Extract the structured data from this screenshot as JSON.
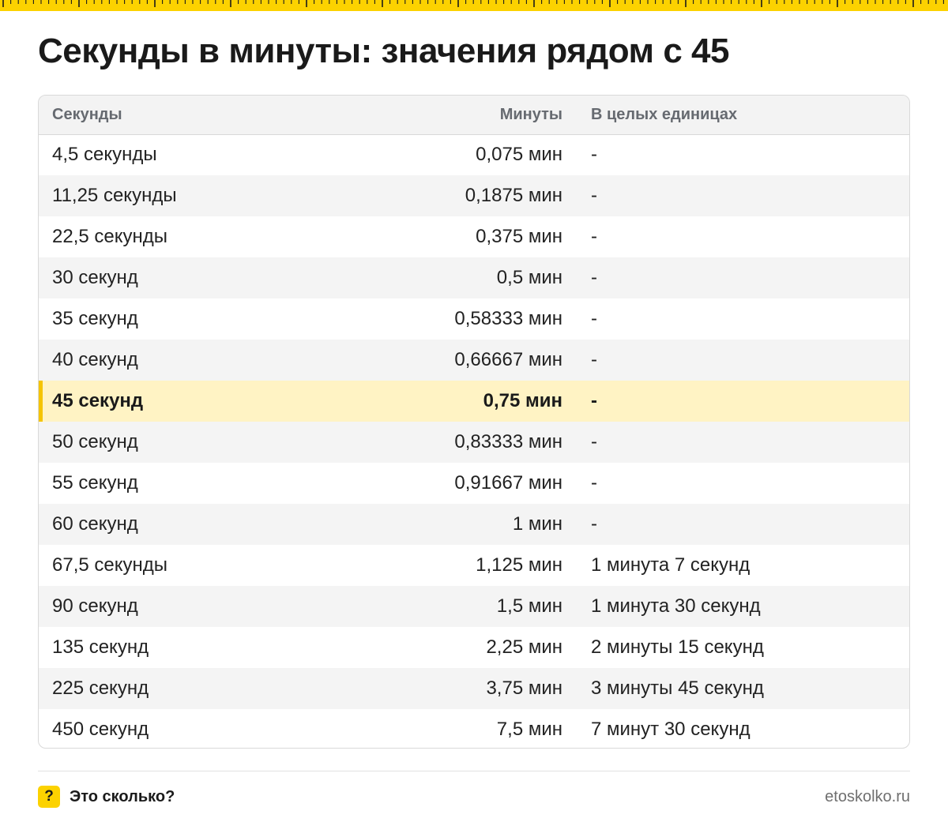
{
  "page": {
    "title": "Секунды в минуты: значения рядом с 45",
    "accent_color": "#fcd200",
    "highlight_color": "#fff3c4"
  },
  "table": {
    "headers": {
      "seconds": "Секунды",
      "minutes": "Минуты",
      "whole_units": "В целых единицах"
    },
    "highlighted_row": 6,
    "rows": [
      {
        "seconds": "4,5 секунды",
        "minutes": "0,075 мин",
        "whole": "-"
      },
      {
        "seconds": "11,25 секунды",
        "minutes": "0,1875 мин",
        "whole": "-"
      },
      {
        "seconds": "22,5 секунды",
        "minutes": "0,375 мин",
        "whole": "-"
      },
      {
        "seconds": "30 секунд",
        "minutes": "0,5 мин",
        "whole": "-"
      },
      {
        "seconds": "35 секунд",
        "minutes": "0,58333 мин",
        "whole": "-"
      },
      {
        "seconds": "40 секунд",
        "minutes": "0,66667 мин",
        "whole": "-"
      },
      {
        "seconds": "45 секунд",
        "minutes": "0,75 мин",
        "whole": "-"
      },
      {
        "seconds": "50 секунд",
        "minutes": "0,83333 мин",
        "whole": "-"
      },
      {
        "seconds": "55 секунд",
        "minutes": "0,91667 мин",
        "whole": "-"
      },
      {
        "seconds": "60 секунд",
        "minutes": "1 мин",
        "whole": "-"
      },
      {
        "seconds": "67,5 секунды",
        "minutes": "1,125 мин",
        "whole": "1 минута 7 секунд"
      },
      {
        "seconds": "90 секунд",
        "minutes": "1,5 мин",
        "whole": "1 минута 30 секунд"
      },
      {
        "seconds": "135 секунд",
        "minutes": "2,25 мин",
        "whole": "2 минуты 15 секунд"
      },
      {
        "seconds": "225 секунд",
        "minutes": "3,75 мин",
        "whole": "3 минуты 45 секунд"
      },
      {
        "seconds": "450 секунд",
        "minutes": "7,5 мин",
        "whole": "7 минут 30 секунд"
      }
    ]
  },
  "footer": {
    "badge_icon": "question-mark-icon",
    "badge_glyph": "?",
    "brand": "Это сколько?",
    "site": "etoskolko.ru"
  }
}
